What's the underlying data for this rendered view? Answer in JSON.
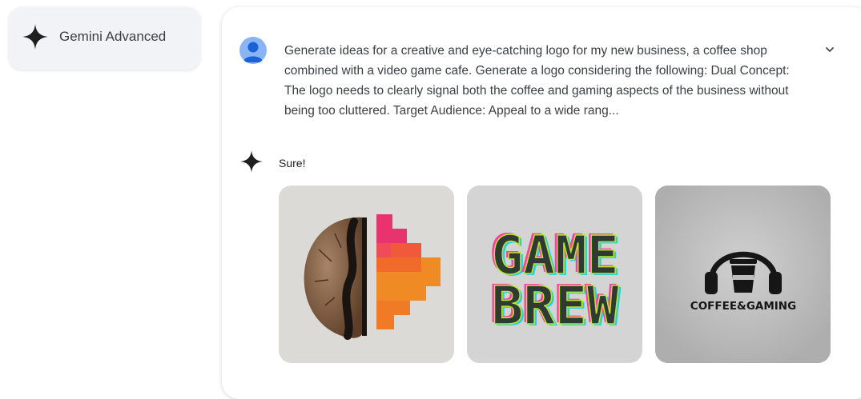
{
  "badge": {
    "label": "Gemini Advanced"
  },
  "conversation": {
    "user_prompt": "Generate ideas for a creative and eye-catching logo for my new business, a coffee shop combined with a video game cafe. Generate a logo considering the following: Dual Concept: The logo needs to clearly signal both the coffee and gaming aspects of the business without being too cluttered. Target Audience: Appeal to a wide rang...",
    "reply_text": "Sure!"
  },
  "images": [
    {
      "alt": "coffee bean and pixel stair logo"
    },
    {
      "line1": "GAME",
      "line2": "BREW"
    },
    {
      "text": "COFFEE&GAMING"
    }
  ],
  "colors": {
    "avatar": "#89b4f8",
    "card_bg": "#ffffff",
    "badge_bg": "#f2f3f6",
    "pixel_pink": "#e8336e",
    "pixel_orange": "#f08a24",
    "game_text_fill": "#2f3a33"
  },
  "icons": {
    "badge_icon": "gemini-sparkle-icon",
    "expand_icon": "chevron-down-icon",
    "reply_icon": "gemini-sparkle-icon",
    "avatar_icon": "user-avatar-icon"
  }
}
